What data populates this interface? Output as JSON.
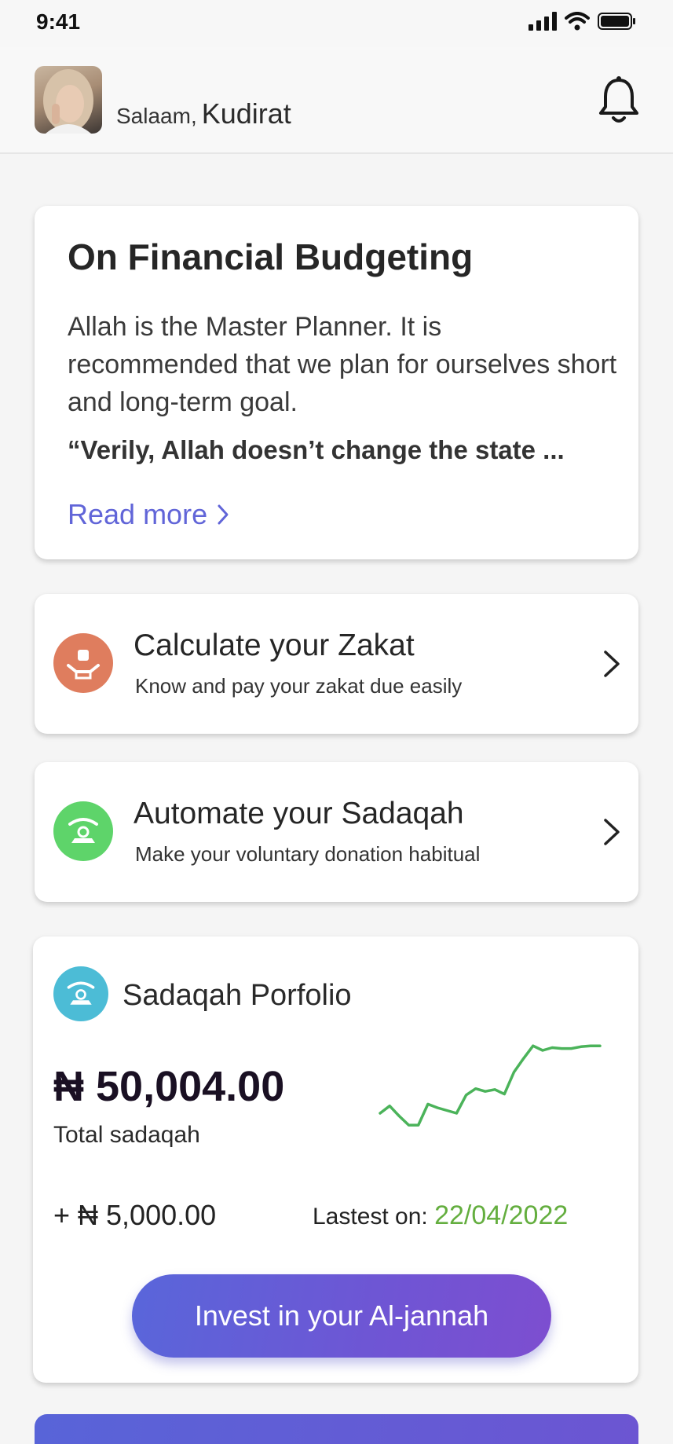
{
  "status_bar": {
    "time": "9:41"
  },
  "header": {
    "greeting_prefix": "Salaam,",
    "user_name": "Kudirat"
  },
  "budget_card": {
    "title": "On Financial Budgeting",
    "body": "Allah is the Master Planner. It is recommended that we plan for ourselves short and long-term goal.",
    "quote": "“Verily, Allah doesn’t change the state ...",
    "read_more": "Read more"
  },
  "zakat_card": {
    "title": "Calculate your Zakat",
    "subtitle": "Know and pay your zakat due easily",
    "icon_color": "#df7d5e"
  },
  "sadaqah_card": {
    "title": "Automate your Sadaqah",
    "subtitle": "Make your voluntary donation habitual",
    "icon_color": "#5ed46a"
  },
  "portfolio": {
    "title": "Sadaqah Porfolio",
    "total_amount": "₦ 50,004.00",
    "total_label": "Total sadaqah",
    "change": "+ ₦ 5,000.00",
    "latest_label": "Lastest  on:",
    "latest_date": "22/04/2022",
    "invest_button": "Invest in your Al-jannah",
    "trend_color": "#4bb35a",
    "trend": [
      0.25,
      0.33,
      0.22,
      0.12,
      0.12,
      0.35,
      0.31,
      0.28,
      0.25,
      0.45,
      0.52,
      0.49,
      0.51,
      0.46,
      0.7,
      0.85,
      0.99,
      0.94,
      0.97,
      0.96,
      0.96,
      0.98,
      0.99,
      0.99
    ]
  }
}
